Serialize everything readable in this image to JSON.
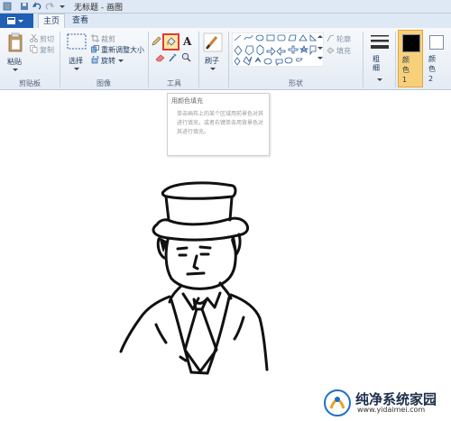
{
  "window": {
    "title": "无标题 - 画图"
  },
  "tabs": [
    {
      "label": "主页"
    },
    {
      "label": "查看"
    }
  ],
  "clipboard": {
    "paste": "粘贴",
    "cut": "剪切",
    "copy": "复制",
    "group": "剪贴板"
  },
  "image": {
    "select": "选择",
    "crop": "裁剪",
    "resize": "重新调整大小",
    "rotate": "旋转",
    "group": "图像"
  },
  "tools": {
    "group": "工具"
  },
  "brushes": {
    "label": "刷子"
  },
  "shapes": {
    "outline": "轮廓",
    "fill": "填充",
    "group": "形状"
  },
  "size": {
    "label": "粗细"
  },
  "colors": {
    "color1": "颜色 1",
    "color2": "颜色 2",
    "color1_value": "#000000",
    "color2_value": "#ffffff"
  },
  "tooltip": {
    "title": "用颜色填充",
    "body": "单击画布上的某个区域用前景色对其进行填充，或者右键单击用背景色对其进行填充。"
  },
  "watermark": {
    "title": "纯净系统家园",
    "url": "www.yidaimei.com"
  },
  "accent": {
    "file_button": "#1f5fb4",
    "highlight": "#e23b2e",
    "selected_color": "#f9d07a"
  }
}
